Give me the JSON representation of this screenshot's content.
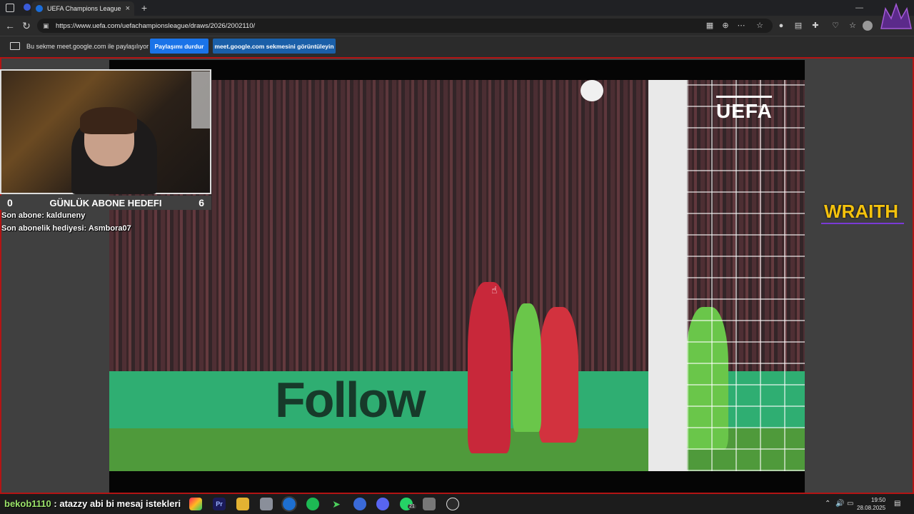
{
  "browser": {
    "tab_title": "UEFA Champions League: Le",
    "close_tab": "×",
    "new_tab": "+",
    "url": "https://www.uefa.com/uefachampionsleague/draws/2026/2002110/"
  },
  "share_bar": {
    "message": "Bu sekme meet.google.com ile paylaşılıyor",
    "stop_button": "Paylaşımı durdur",
    "view_button": "meet.google.com sekmesini görüntüleyin"
  },
  "video": {
    "broadcaster_logo": "UEFA",
    "board_text": "Follow"
  },
  "stream_overlay": {
    "goal_label": "GÜNLÜK ABONE HEDEFI",
    "goal_current": "0",
    "goal_target": "6",
    "last_sub_label": "Son abone: kalduneny",
    "last_gift_label": "Son abonelik hediyesi: Asmbora07",
    "sponsor": "WRAITH"
  },
  "chat": {
    "user": "bekob1110",
    "message": ": atazzy abi bi mesaj istekleri"
  },
  "taskbar": {
    "whatsapp_badge": "21",
    "time": "19:50",
    "date": "28.08.2025"
  },
  "colors": {
    "accent_blue": "#1a73e8",
    "capture_border": "#b31414",
    "sponsor_yellow": "#f4c20d",
    "chat_user": "#9be36a"
  }
}
